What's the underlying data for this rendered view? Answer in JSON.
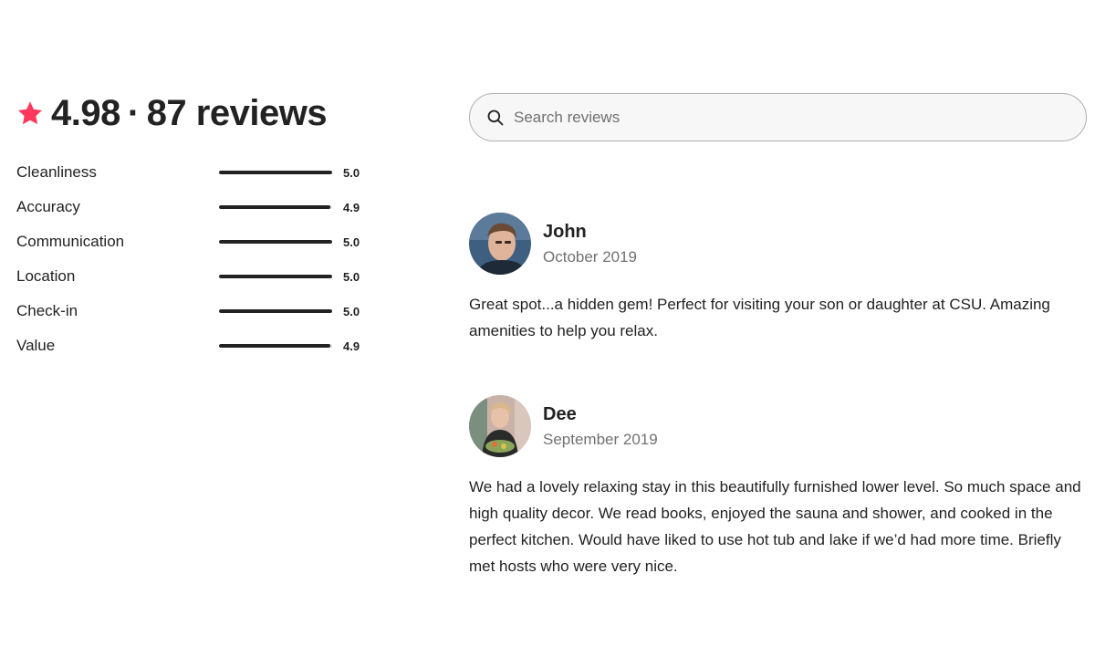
{
  "summary": {
    "rating": "4.98",
    "separator": "·",
    "review_count": "87 reviews",
    "star_icon": "star-icon",
    "star_color": "#FF385C"
  },
  "categories": [
    {
      "label": "Cleanliness",
      "score": "5.0",
      "value": 5.0
    },
    {
      "label": "Accuracy",
      "score": "4.9",
      "value": 4.9
    },
    {
      "label": "Communication",
      "score": "5.0",
      "value": 5.0
    },
    {
      "label": "Location",
      "score": "5.0",
      "value": 5.0
    },
    {
      "label": "Check-in",
      "score": "5.0",
      "value": 5.0
    },
    {
      "label": "Value",
      "score": "4.9",
      "value": 4.9
    }
  ],
  "search": {
    "placeholder": "Search reviews",
    "icon": "search-icon"
  },
  "reviews": [
    {
      "name": "John",
      "date": "October 2019",
      "text": "Great spot...a hidden gem! Perfect for visiting your son or daughter at CSU. Amazing amenities to help you relax."
    },
    {
      "name": "Dee",
      "date": "September 2019",
      "text": "We had a lovely relaxing stay in this beautifully furnished lower level. So much space and high quality decor. We read books, enjoyed the sauna and shower, and cooked in the perfect kitchen. Would have liked to use hot tub and lake if we’d had more time. Briefly met hosts who were very nice."
    }
  ]
}
